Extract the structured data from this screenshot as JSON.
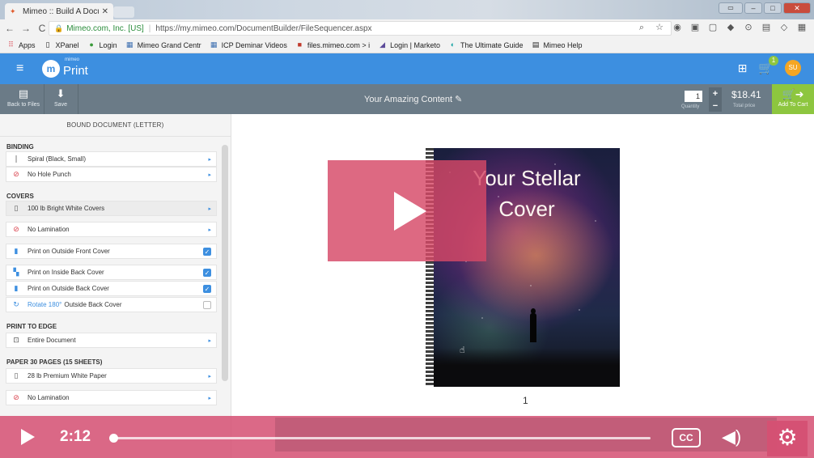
{
  "browser": {
    "tab_title": "Mimeo :: Build A Docume",
    "address_secure": "Mimeo.com, Inc. [US]",
    "address_url": "https://my.mimeo.com/DocumentBuilder/FileSequencer.aspx",
    "bookmarks": [
      "Apps",
      "XPanel",
      "Login",
      "Mimeo Grand Centr",
      "ICP Deminar Videos",
      "files.mimeo.com > i",
      "Login | Marketo",
      "The Ultimate Guide",
      "Mimeo Help"
    ]
  },
  "header": {
    "logo_small": "mimeo",
    "logo_word": "Print",
    "cart_count": "1",
    "avatar_initials": "SU"
  },
  "toolbar": {
    "back_label": "Back to Files",
    "save_label": "Save",
    "document_title": "Your Amazing Content",
    "quantity": "1",
    "quantity_label": "Quantity",
    "plus": "+",
    "minus": "−",
    "price": "$18.41",
    "price_label": "Total price",
    "cart_label": "Add To Cart"
  },
  "panel": {
    "heading": "BOUND DOCUMENT (LETTER)",
    "sections": {
      "binding": "BINDING",
      "covers": "COVERS",
      "print_to_edge": "PRINT TO EDGE",
      "paper": "PAPER 30 PAGES (15 SHEETS)"
    },
    "options": {
      "spiral": "Spiral (Black, Small)",
      "no_hole_punch": "No Hole Punch",
      "covers_stock": "100 lb Bright White Covers",
      "no_lamination_cover": "No Lamination",
      "outside_front": "Print on Outside Front Cover",
      "inside_back": "Print on Inside Back Cover",
      "outside_back": "Print on Outside Back Cover",
      "rotate_blue": "Rotate 180°",
      "rotate_rest": "Outside Back Cover",
      "entire_document": "Entire Document",
      "paper_stock": "28 lb Premium White Paper",
      "no_lamination_paper": "No Lamination"
    }
  },
  "preview": {
    "cover_line1": "Your Stellar",
    "cover_line2": "Cover",
    "page_number": "1"
  },
  "video": {
    "time": "2:12",
    "cc_label": "CC"
  }
}
